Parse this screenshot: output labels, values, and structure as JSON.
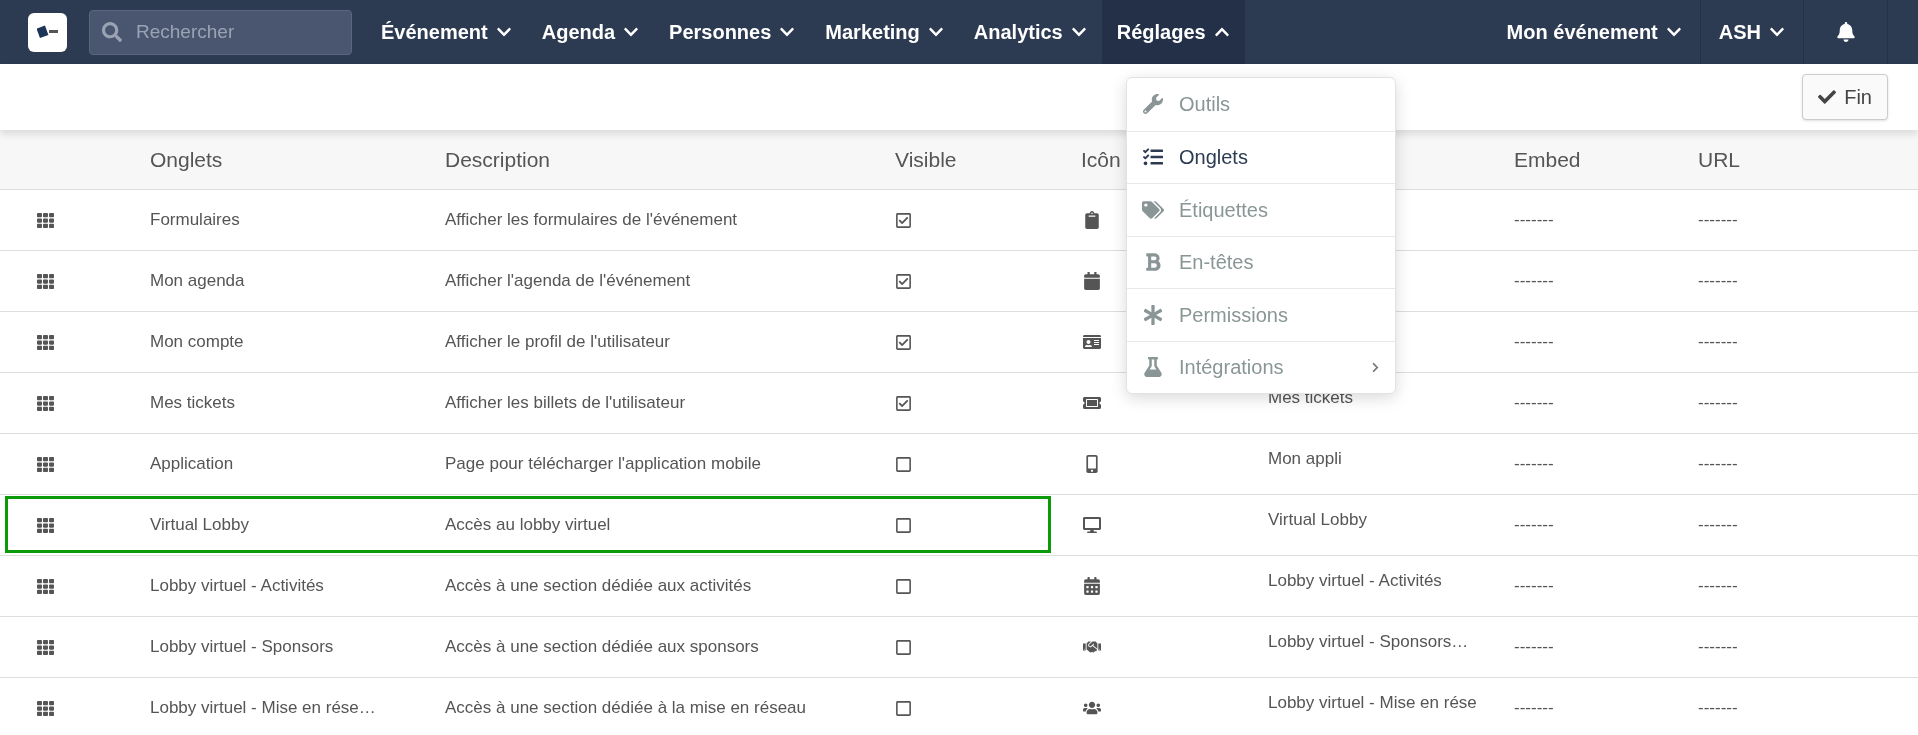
{
  "nav": {
    "search": {
      "placeholder": "Rechercher"
    },
    "items": [
      {
        "label": "Événement",
        "selected": false
      },
      {
        "label": "Agenda",
        "selected": false
      },
      {
        "label": "Personnes",
        "selected": false
      },
      {
        "label": "Marketing",
        "selected": false
      },
      {
        "label": "Analytics",
        "selected": false
      },
      {
        "label": "Réglages",
        "selected": true
      }
    ],
    "right": [
      {
        "label": "Mon événement"
      },
      {
        "label": "ASH"
      }
    ]
  },
  "toolbar": {
    "done_button": "Fin"
  },
  "menu": {
    "items": [
      {
        "label": "Outils",
        "selected": false,
        "submenu": false
      },
      {
        "label": "Onglets",
        "selected": true,
        "submenu": false
      },
      {
        "label": "Étiquettes",
        "selected": false,
        "submenu": false
      },
      {
        "label": "En-têtes",
        "selected": false,
        "submenu": false
      },
      {
        "label": "Permissions",
        "selected": false,
        "submenu": false
      },
      {
        "label": "Intégrations",
        "selected": false,
        "submenu": true
      }
    ]
  },
  "table": {
    "columns": [
      "Onglets",
      "Description",
      "Visible",
      "Icôn",
      "",
      "Embed",
      "URL"
    ],
    "rows": [
      {
        "tab": "Formulaires",
        "description": "Afficher les formulaires de l'événement",
        "visible": true,
        "name": "",
        "embed": "-------",
        "url": "-------",
        "highlighted": false
      },
      {
        "tab": "Mon agenda",
        "description": "Afficher l'agenda de l'événement",
        "visible": true,
        "name": "",
        "embed": "-------",
        "url": "-------",
        "highlighted": false
      },
      {
        "tab": "Mon compte",
        "description": "Afficher le profil de l'utilisateur",
        "visible": true,
        "name": "",
        "embed": "-------",
        "url": "-------",
        "highlighted": false
      },
      {
        "tab": "Mes tickets",
        "description": "Afficher les billets de l'utilisateur",
        "visible": true,
        "name": "Mes tickets",
        "embed": "-------",
        "url": "-------",
        "highlighted": false
      },
      {
        "tab": "Application",
        "description": "Page pour télécharger l'application mobile",
        "visible": false,
        "name": "Mon appli",
        "embed": "-------",
        "url": "-------",
        "highlighted": false
      },
      {
        "tab": "Virtual Lobby",
        "description": "Accès au lobby virtuel",
        "visible": false,
        "name": "Virtual Lobby",
        "embed": "-------",
        "url": "-------",
        "highlighted": true
      },
      {
        "tab": "Lobby virtuel - Activités",
        "description": "Accès à une section dédiée aux activités",
        "visible": false,
        "name": "Lobby virtuel - Activités",
        "embed": "-------",
        "url": "-------",
        "highlighted": false
      },
      {
        "tab": "Lobby virtuel - Sponsors",
        "description": "Accès à une section dédiée aux sponsors",
        "visible": false,
        "name": "Lobby virtuel - Sponsors…",
        "embed": "-------",
        "url": "-------",
        "highlighted": false
      },
      {
        "tab": "Lobby virtuel - Mise en rése…",
        "description": "Accès à une section dédiée à la mise en réseau",
        "visible": false,
        "name": "Lobby virtuel - Mise en rése",
        "embed": "-------",
        "url": "-------",
        "highlighted": false
      }
    ]
  }
}
